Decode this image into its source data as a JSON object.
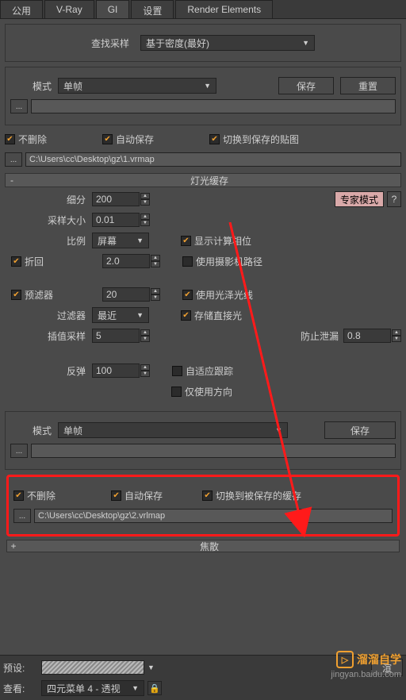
{
  "tabs": {
    "t0": "公用",
    "t1": "V-Ray",
    "t2": "GI",
    "t3": "设置",
    "t4": "Render Elements"
  },
  "search": {
    "label": "查找采样",
    "value": "基于密度(最好)"
  },
  "mode1": {
    "label": "模式",
    "value": "单帧",
    "save": "保存",
    "reset": "重置",
    "dots": "..."
  },
  "autosave1": {
    "keep": "不删除",
    "auto": "自动保存",
    "switch": "切换到保存的贴图",
    "path": "C:\\Users\\cc\\Desktop\\gz\\1.vrmap",
    "dots": "..."
  },
  "section_light": {
    "title": "灯光缓存",
    "minus": "-"
  },
  "light": {
    "subdiv_l": "细分",
    "subdiv": "200",
    "sampsz_l": "采样大小",
    "sampsz": "0.01",
    "scale_l": "比例",
    "scale": "屏幕",
    "showphase": "显示计算相位",
    "retrace_l": "折回",
    "retrace": "2.0",
    "usecam": "使用摄影机路径",
    "prefilter_l": "预滤器",
    "prefilter": "20",
    "useglossy": "使用光泽光线",
    "filter_l": "过滤器",
    "filter": "最近",
    "storedir": "存储直接光",
    "interp_l": "插值采样",
    "interp": "5",
    "leak_l": "防止泄漏",
    "leak": "0.8",
    "bounce_l": "反弹",
    "bounce": "100",
    "adaptive": "自适应跟踪",
    "only": "仅使用方向",
    "expert": "专家模式",
    "q": "?"
  },
  "mode2": {
    "label": "模式",
    "value": "单帧",
    "save": "保存",
    "dots": "..."
  },
  "autosave2": {
    "keep": "不删除",
    "auto": "自动保存",
    "switch": "切换到被保存的缓存",
    "path": "C:\\Users\\cc\\Desktop\\gz\\2.vrlmap",
    "dots": "..."
  },
  "footer_sec": {
    "plus": "+",
    "title": "焦散"
  },
  "bottom": {
    "preset_l": "预设:",
    "view_l": "查看:",
    "view": "四元菜单 4 - 透视",
    "render": "渲"
  },
  "wm": {
    "brand": "溜溜自学",
    "url": "jingyan.baidu.com",
    "icon": "▷"
  }
}
